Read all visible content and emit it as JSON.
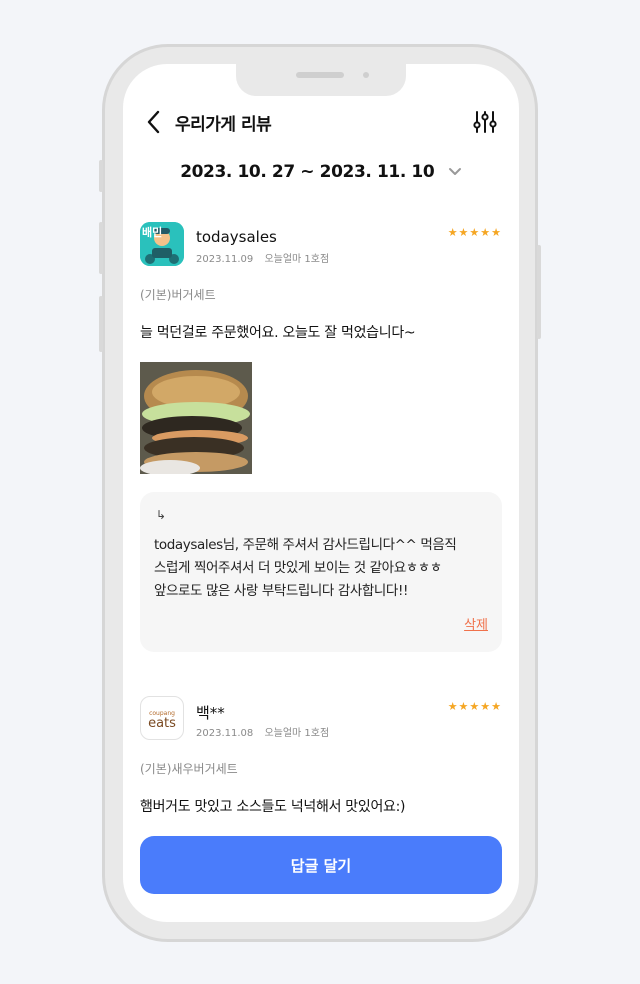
{
  "header": {
    "title": "우리가게 리뷰"
  },
  "date_range": {
    "label": "2023. 10. 27 ~ 2023. 11. 10"
  },
  "reviews": [
    {
      "user": "todaysales",
      "date": "2023.11.09",
      "store": "오늘얼마 1호점",
      "rating": 5,
      "stars": "★★★★★",
      "menu": "(기본)버거세트",
      "text": "늘 먹던걸로 주문했어요. 오늘도 잘 먹었습니다~",
      "platform_logo": "배민",
      "reply": {
        "arrow": "↳",
        "line1": "todaysales님, 주문해 주셔서 감사드립니다^^ 먹음직",
        "line2": "스럽게 찍어주셔서 더 맛있게 보이는 것 같아요ㅎㅎㅎ",
        "line3": "앞으로도 많은 사랑 부탁드립니다 감사합니다!!",
        "delete_label": "삭제"
      }
    },
    {
      "user": "백**",
      "date": "2023.11.08",
      "store": "오늘얼마 1호점",
      "rating": 5,
      "stars": "★★★★★",
      "menu": "(기본)새우버거세트",
      "text": "햄버거도 맛있고 소스들도 넉넉해서 맛있어요:)",
      "platform_logo_small": "coupang",
      "platform_logo_large": "eats"
    }
  ],
  "actions": {
    "reply_button": "답글 달기"
  },
  "colors": {
    "accent": "#4a7cfb",
    "star": "#f5a623",
    "delete": "#f0714b"
  }
}
